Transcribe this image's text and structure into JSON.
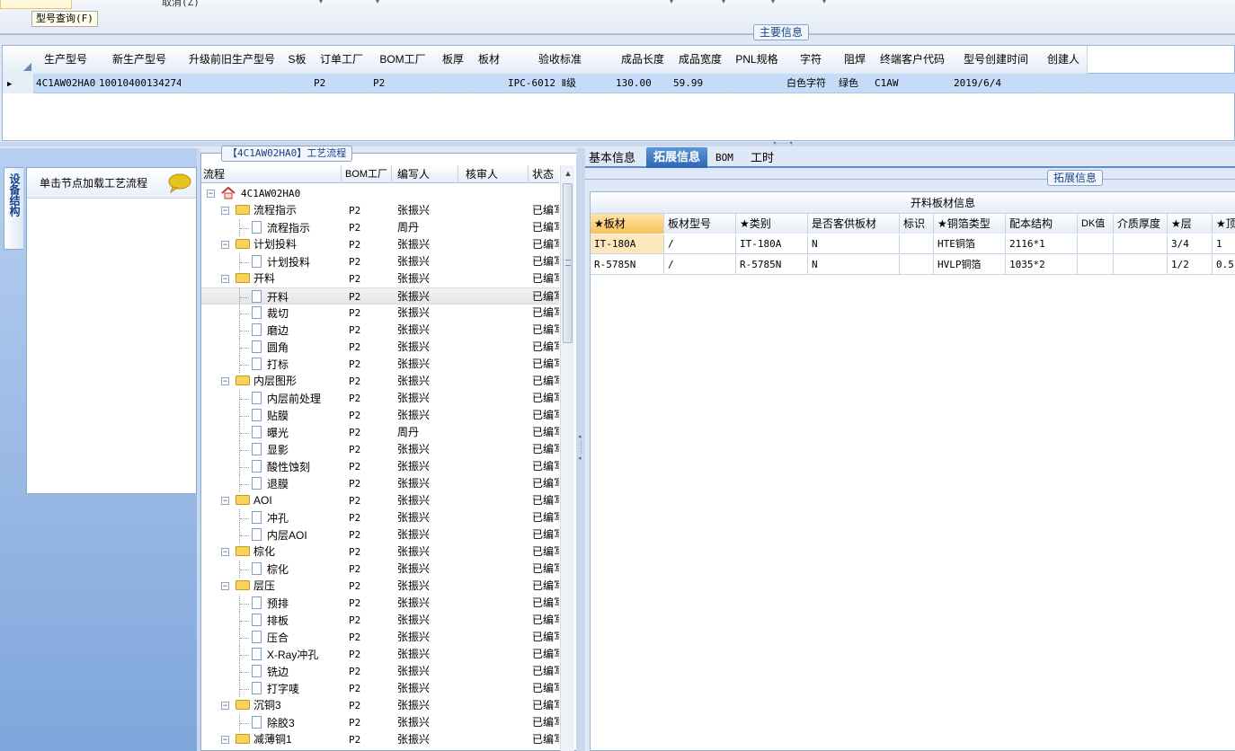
{
  "toolbar": {
    "cancel_label": "取消(Z)",
    "model_query_label": "型号查询(F)"
  },
  "main_group": {
    "title": "主要信息"
  },
  "main_grid": {
    "columns": [
      "生产型号",
      "新生产型号",
      "升级前旧生产型号",
      "S板",
      "订单工厂",
      "BOM工厂",
      "板厚",
      "板材",
      "验收标准",
      "成品长度",
      "成品宽度",
      "PNL规格",
      "字符",
      "阻焊",
      "终端客户代码",
      "型号创建时间",
      "创建人"
    ],
    "row": [
      "4C1AW02HA0",
      "10010400134274",
      "",
      "",
      "P2",
      "P2",
      "",
      "",
      "IPC-6012 Ⅱ级",
      "130.00",
      "59.99",
      "",
      "白色字符",
      "绿色",
      "C1AW",
      "2019/6/4",
      ""
    ]
  },
  "left_panel": {
    "vertical_tab": "设备结构",
    "hint": "单击节点加载工艺流程"
  },
  "flow_group": {
    "title": "【4C1AW02HA0】工艺流程"
  },
  "flow_tree": {
    "columns": [
      "流程",
      "BOM工厂",
      "编写人",
      "核审人",
      "状态"
    ],
    "root": "4C1AW02HA0",
    "rows": [
      {
        "name": "流程指示",
        "level": 1,
        "folder": true,
        "bom": "P2",
        "author": "张振兴",
        "status": "已编写"
      },
      {
        "name": "流程指示",
        "level": 2,
        "folder": false,
        "bom": "P2",
        "author": "周丹",
        "status": "已编写"
      },
      {
        "name": "计划投料",
        "level": 1,
        "folder": true,
        "bom": "P2",
        "author": "张振兴",
        "status": "已编写"
      },
      {
        "name": "计划投料",
        "level": 2,
        "folder": false,
        "bom": "P2",
        "author": "张振兴",
        "status": "已编写"
      },
      {
        "name": "开料",
        "level": 1,
        "folder": true,
        "bom": "P2",
        "author": "张振兴",
        "status": "已编写"
      },
      {
        "name": "开料",
        "level": 2,
        "folder": false,
        "bom": "P2",
        "author": "张振兴",
        "status": "已编写",
        "selected": true
      },
      {
        "name": "裁切",
        "level": 2,
        "folder": false,
        "bom": "P2",
        "author": "张振兴",
        "status": "已编写"
      },
      {
        "name": "磨边",
        "level": 2,
        "folder": false,
        "bom": "P2",
        "author": "张振兴",
        "status": "已编写"
      },
      {
        "name": "圆角",
        "level": 2,
        "folder": false,
        "bom": "P2",
        "author": "张振兴",
        "status": "已编写"
      },
      {
        "name": "打标",
        "level": 2,
        "folder": false,
        "bom": "P2",
        "author": "张振兴",
        "status": "已编写"
      },
      {
        "name": "内层图形",
        "level": 1,
        "folder": true,
        "bom": "P2",
        "author": "张振兴",
        "status": "已编写"
      },
      {
        "name": "内层前处理",
        "level": 2,
        "folder": false,
        "bom": "P2",
        "author": "张振兴",
        "status": "已编写"
      },
      {
        "name": "贴膜",
        "level": 2,
        "folder": false,
        "bom": "P2",
        "author": "张振兴",
        "status": "已编写"
      },
      {
        "name": "曝光",
        "level": 2,
        "folder": false,
        "bom": "P2",
        "author": "周丹",
        "status": "已编写"
      },
      {
        "name": "显影",
        "level": 2,
        "folder": false,
        "bom": "P2",
        "author": "张振兴",
        "status": "已编写"
      },
      {
        "name": "酸性蚀刻",
        "level": 2,
        "folder": false,
        "bom": "P2",
        "author": "张振兴",
        "status": "已编写"
      },
      {
        "name": "退膜",
        "level": 2,
        "folder": false,
        "bom": "P2",
        "author": "张振兴",
        "status": "已编写"
      },
      {
        "name": "AOI",
        "level": 1,
        "folder": true,
        "bom": "P2",
        "author": "张振兴",
        "status": "已编写"
      },
      {
        "name": "冲孔",
        "level": 2,
        "folder": false,
        "bom": "P2",
        "author": "张振兴",
        "status": "已编写"
      },
      {
        "name": "内层AOI",
        "level": 2,
        "folder": false,
        "bom": "P2",
        "author": "张振兴",
        "status": "已编写"
      },
      {
        "name": "棕化",
        "level": 1,
        "folder": true,
        "bom": "P2",
        "author": "张振兴",
        "status": "已编写"
      },
      {
        "name": "棕化",
        "level": 2,
        "folder": false,
        "bom": "P2",
        "author": "张振兴",
        "status": "已编写"
      },
      {
        "name": "层压",
        "level": 1,
        "folder": true,
        "bom": "P2",
        "author": "张振兴",
        "status": "已编写"
      },
      {
        "name": "预排",
        "level": 2,
        "folder": false,
        "bom": "P2",
        "author": "张振兴",
        "status": "已编写"
      },
      {
        "name": "排板",
        "level": 2,
        "folder": false,
        "bom": "P2",
        "author": "张振兴",
        "status": "已编写"
      },
      {
        "name": "压合",
        "level": 2,
        "folder": false,
        "bom": "P2",
        "author": "张振兴",
        "status": "已编写"
      },
      {
        "name": "X-Ray冲孔",
        "level": 2,
        "folder": false,
        "bom": "P2",
        "author": "张振兴",
        "status": "已编写"
      },
      {
        "name": "铣边",
        "level": 2,
        "folder": false,
        "bom": "P2",
        "author": "张振兴",
        "status": "已编写"
      },
      {
        "name": "打字唛",
        "level": 2,
        "folder": false,
        "bom": "P2",
        "author": "张振兴",
        "status": "已编写"
      },
      {
        "name": "沉铜3",
        "level": 1,
        "folder": true,
        "bom": "P2",
        "author": "张振兴",
        "status": "已编写"
      },
      {
        "name": "除胶3",
        "level": 2,
        "folder": false,
        "bom": "P2",
        "author": "张振兴",
        "status": "已编写"
      },
      {
        "name": "减薄铜1",
        "level": 1,
        "folder": true,
        "bom": "P2",
        "author": "张振兴",
        "status": "已编写"
      }
    ]
  },
  "right_tabs": [
    "基本信息",
    "拓展信息",
    "BOM",
    "工时"
  ],
  "ext_group": {
    "title": "拓展信息"
  },
  "material_grid": {
    "caption": "开料板材信息",
    "columns": [
      "★板材",
      "板材型号",
      "★类别",
      "是否客供板材",
      "标识",
      "★铜箔类型",
      "配本结构",
      "DK值",
      "介质厚度",
      "★层",
      "★顶"
    ],
    "rows": [
      [
        "IT-180A",
        "/",
        "IT-180A",
        "N",
        "",
        "HTE铜箔",
        "2116*1",
        "",
        "",
        "3/4",
        "1"
      ],
      [
        "R-5785N",
        "/",
        "R-5785N",
        "N",
        "",
        "HVLP铜箔",
        "1035*2",
        "",
        "",
        "1/2",
        "0.5"
      ]
    ]
  }
}
